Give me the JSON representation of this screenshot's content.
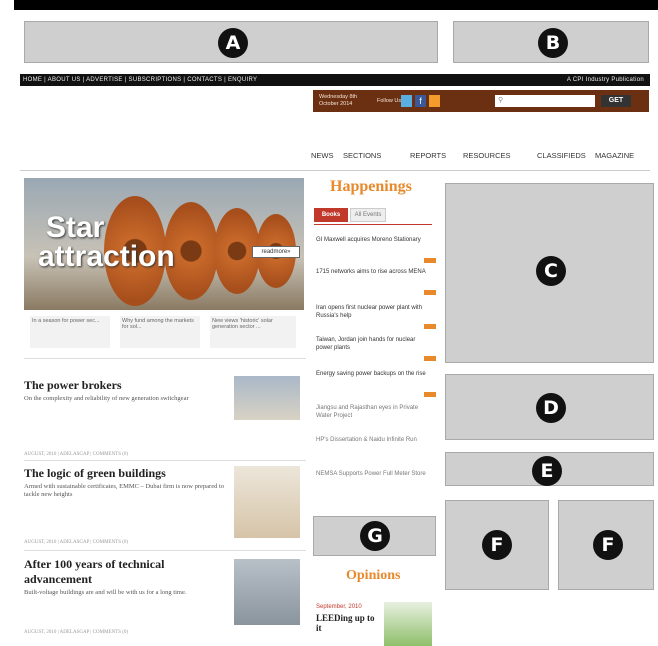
{
  "labels": {
    "A": "A",
    "B": "B",
    "C": "C",
    "D": "D",
    "E": "E",
    "F": "F",
    "G": "G"
  },
  "nav": {
    "items": [
      "HOME",
      "ABOUT US",
      "ADVERTISE",
      "SUBSCRIPTIONS",
      "CONTACTS",
      "ENQUIRY"
    ],
    "tagline": "A CPI Industry Publication"
  },
  "util": {
    "date": "Wednesday 8th October 2014",
    "follow": "Follow Us",
    "go": "GET"
  },
  "mainnav": [
    "NEWS",
    "SECTIONS",
    "REPORTS",
    "RESOURCES",
    "CLASSIFIEDS",
    "MAGAZINE"
  ],
  "hero": {
    "line1": "Star",
    "line2": "attraction",
    "readmore": "readmore»",
    "thumbs": [
      "In a season for power sec...",
      "Why fund among the markets for sol...",
      "New views 'historic' solar generation sector ..."
    ]
  },
  "happenings": {
    "title": "Happenings",
    "tabs": [
      "Books",
      "All Events"
    ],
    "items": [
      "GI Maxwell acquires Moreno Stationary",
      "1715 networks aims to rise across MENA",
      "Iran opens first nuclear power plant with Russia's help",
      "Taiwan, Jordan join hands for nuclear power plants",
      "Energy saving power backups on the rise",
      "Jiangsu and Rajasthan eyes in Private Water Project",
      "HP's Dissertation & Naidu Infinite Run",
      "NEMSA Supports Power Full Meter Store"
    ]
  },
  "opinions": {
    "title": "Opinions",
    "date": "September, 2010",
    "headline": "LEEDing up to it"
  },
  "stories": [
    {
      "title": "The power brokers",
      "desc": "On the complexity and reliability of new generation switchgear",
      "meta": "AUGUST, 2010 | ADELASGAP | COMMENTS (0)"
    },
    {
      "title": "The logic of green buildings",
      "desc": "Armed with sustainable certificates, EMMC – Dubai firm is now prepared to tackle new heights",
      "meta": "AUGUST, 2010 | ADELASGAP | COMMENTS (0)"
    },
    {
      "title": "After 100 years of technical advancement",
      "desc": "Built-voltage buildings are and will be with us for a long time.",
      "meta": "AUGUST, 2010 | ADELASGAP | COMMENTS (0)"
    }
  ]
}
